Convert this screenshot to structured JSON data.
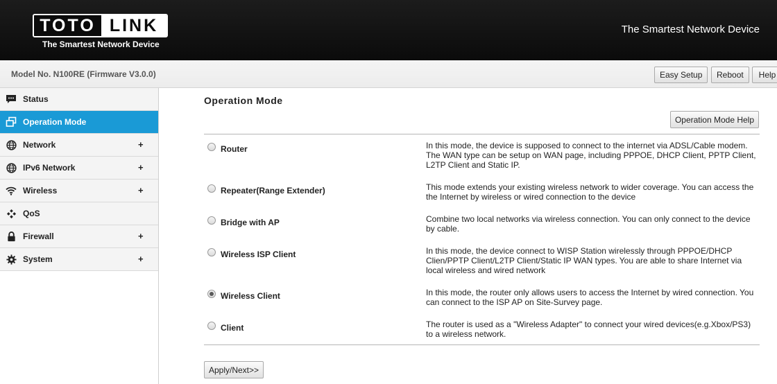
{
  "header": {
    "logo_left": "TOTO",
    "logo_right": "LINK",
    "logo_tagline": "The Smartest Network Device",
    "tagline": "The Smartest Network Device"
  },
  "topbar": {
    "model": "Model No. N100RE (Firmware V3.0.0)",
    "easy_setup": "Easy Setup",
    "reboot": "Reboot",
    "help": "Help"
  },
  "sidebar": {
    "items": [
      {
        "label": "Status",
        "icon": "chat-icon",
        "expandable": false,
        "active": false
      },
      {
        "label": "Operation Mode",
        "icon": "window-icon",
        "expandable": false,
        "active": true
      },
      {
        "label": "Network",
        "icon": "globe-icon",
        "expandable": true,
        "active": false
      },
      {
        "label": "IPv6 Network",
        "icon": "globe-icon",
        "expandable": true,
        "active": false
      },
      {
        "label": "Wireless",
        "icon": "wifi-icon",
        "expandable": true,
        "active": false
      },
      {
        "label": "QoS",
        "icon": "qos-icon",
        "expandable": false,
        "active": false
      },
      {
        "label": "Firewall",
        "icon": "lock-icon",
        "expandable": true,
        "active": false
      },
      {
        "label": "System",
        "icon": "gear-icon",
        "expandable": true,
        "active": false
      }
    ],
    "expand_glyph": "+"
  },
  "main": {
    "title": "Operation Mode",
    "help_button": "Operation Mode Help",
    "modes": [
      {
        "name": "Router",
        "checked": false,
        "description": "In this mode, the device is supposed to connect to the internet via ADSL/Cable modem. The WAN type can be setup on WAN page, including PPPOE, DHCP Client, PPTP Client, L2TP Client and Static IP."
      },
      {
        "name": "Repeater(Range Extender)",
        "checked": false,
        "description": "This mode extends your existing wireless network to wider coverage. You can access the the Internet by wireless or wired connection to the device"
      },
      {
        "name": "Bridge with AP",
        "checked": false,
        "description": "Combine two local networks via wireless connection. You can only connect to the device by cable."
      },
      {
        "name": "Wireless ISP Client",
        "checked": false,
        "description": "In this mode, the device connect to WISP Station wirelessly through PPPOE/DHCP Clien/PPTP Client/L2TP Client/Static IP WAN types. You are able to share Internet via local wireless and wired network"
      },
      {
        "name": "Wireless Client",
        "checked": true,
        "description": "In this mode, the router only allows users to access the Internet by wired connection. You can connect to the ISP AP on Site-Survey page."
      },
      {
        "name": "Client",
        "checked": false,
        "description": "The router is used as a \"Wireless Adapter\" to connect your wired devices(e.g.Xbox/PS3) to a wireless network."
      }
    ],
    "apply_button": "Apply/Next>>"
  },
  "colors": {
    "header_bg": "#0b0b0b",
    "active_nav": "#1a9ad6",
    "nav_bg": "#f4f4f4"
  }
}
